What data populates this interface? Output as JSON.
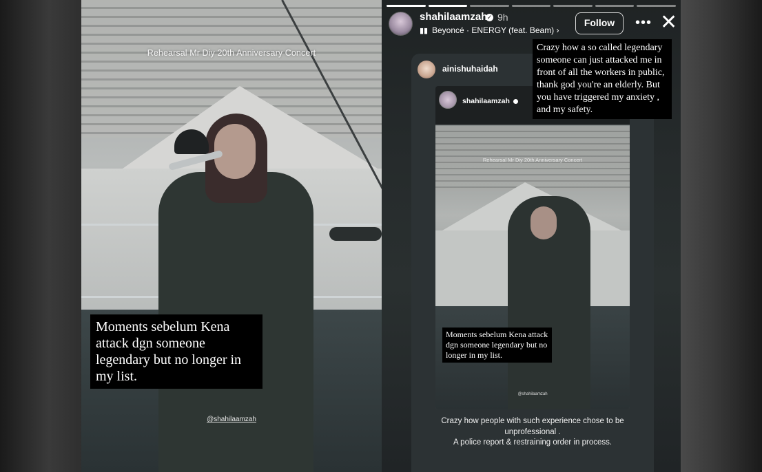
{
  "left_story": {
    "overlay_title": "Rehearsal Mr Diy 20th Anniversary Concert",
    "caption": "Moments sebelum Kena attack dgn someone legendary but no longer in my list.",
    "watermark": "@shahilaamzah"
  },
  "right_story": {
    "header": {
      "username": "shahilaamzah",
      "verified_icon": "verified-badge-icon",
      "time": "9h",
      "music_icon": "audio-wave-icon",
      "music": "Beyoncé · ENERGY (feat. Beam) ›",
      "follow_label": "Follow",
      "more_icon": "more-options-icon",
      "close_icon": "close-icon"
    },
    "progress_segments": [
      true,
      true,
      false,
      false,
      false,
      false,
      false
    ],
    "notice_text": "Crazy how a so called legendary someone can just attacked me in front of all the workers in public, thank god you're an elderly. But you have triggered my anxiety , and my safety.",
    "reshare": {
      "username": "ainishuhaidah",
      "inner_username": "shahilaamzah",
      "inner_title": "Rehearsal Mr Diy 20th Anniversary Concert",
      "inner_caption": "Moments sebelum Kena attack dgn someone legendary but no longer in my list.",
      "inner_watermark": "@shahilaamzah"
    },
    "bottom_text_line1": "Crazy how people with such experience chose to be unprofessional .",
    "bottom_text_line2": "A police report & restraining order in process."
  },
  "colors": {
    "caption_bg": "#000000",
    "caption_text": "#ffffff",
    "follow_border": "#d9d9d9"
  }
}
